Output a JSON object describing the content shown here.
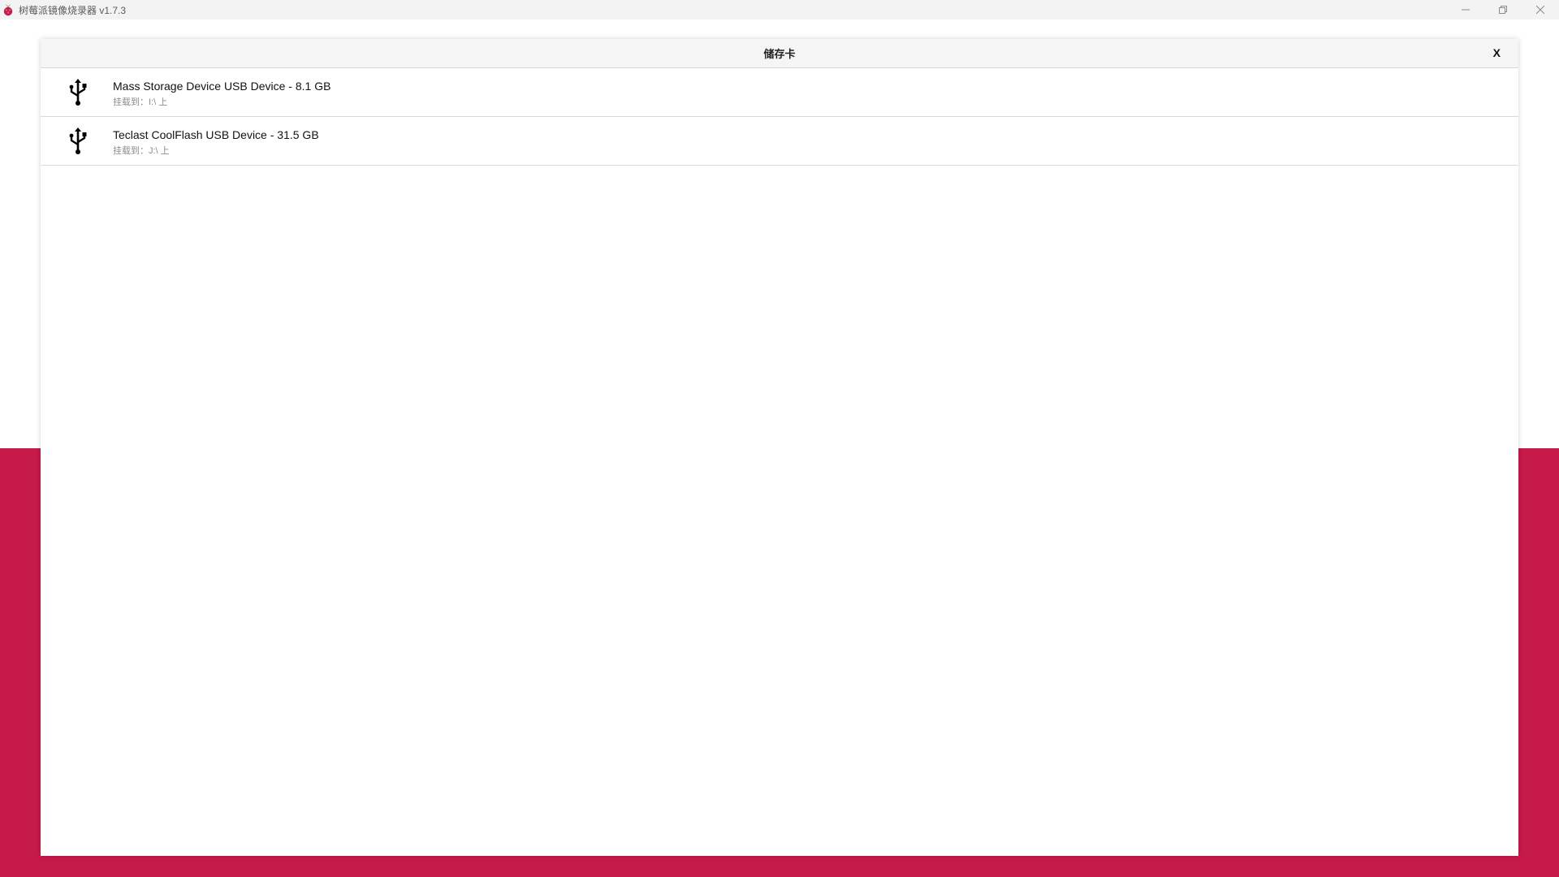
{
  "window": {
    "title": "树莓派镜像烧录器 v1.7.3",
    "icon": "raspberry-pi-logo",
    "controls": {
      "minimize_icon": "minimize-icon",
      "restore_icon": "restore-icon",
      "close_icon": "close-icon"
    }
  },
  "colors": {
    "brand_red": "#c51a4a",
    "background_top": "#ffffff"
  },
  "dialog": {
    "title": "储存卡",
    "close_label": "X",
    "devices": [
      {
        "name": "Mass Storage Device USB Device - 8.1 GB",
        "mount": "挂载到：I:\\ 上",
        "icon": "usb-icon"
      },
      {
        "name": "Teclast CoolFlash USB Device - 31.5 GB",
        "mount": "挂载到：J:\\ 上",
        "icon": "usb-icon"
      }
    ]
  }
}
